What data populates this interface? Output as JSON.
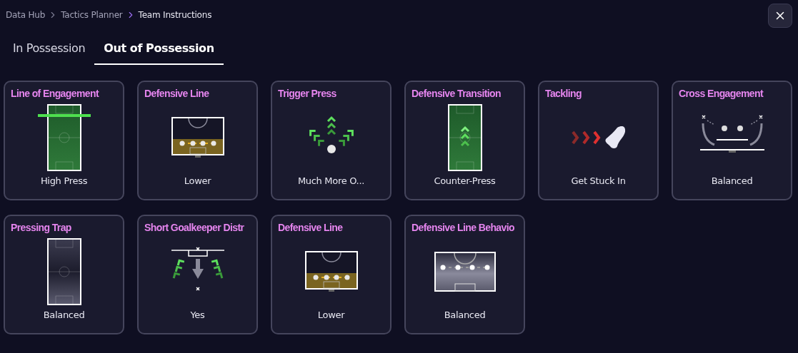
{
  "breadcrumb": [
    {
      "label": "Data Hub",
      "current": false
    },
    {
      "label": "Tactics Planner",
      "current": false
    },
    {
      "label": "Team Instructions",
      "current": true
    }
  ],
  "tabs": [
    {
      "label": "In Possession",
      "selected": false
    },
    {
      "label": "Out of Possession",
      "selected": true
    }
  ],
  "cards": [
    {
      "title": "Line of Engagement",
      "kind": "engagement",
      "value": "High Press"
    },
    {
      "title": "Defensive Line",
      "kind": "defline",
      "value": "Lower"
    },
    {
      "title": "Trigger Press",
      "kind": "trigger",
      "value": "Much More O..."
    },
    {
      "title": "Defensive Transition",
      "kind": "transition",
      "value": "Counter-Press"
    },
    {
      "title": "Tackling",
      "kind": "tackling",
      "value": "Get Stuck In"
    },
    {
      "title": "Cross Engagement",
      "kind": "cross",
      "value": "Balanced"
    },
    {
      "title": "Pressing Trap",
      "kind": "trap",
      "value": "Balanced"
    },
    {
      "title": "Short Goalkeeper Distr",
      "kind": "goalkeeper",
      "value": "Yes"
    },
    {
      "title": "Defensive Line",
      "kind": "defline",
      "value": "Lower"
    },
    {
      "title": "Defensive Line Behavio",
      "kind": "behaviour",
      "value": "Balanced"
    }
  ]
}
